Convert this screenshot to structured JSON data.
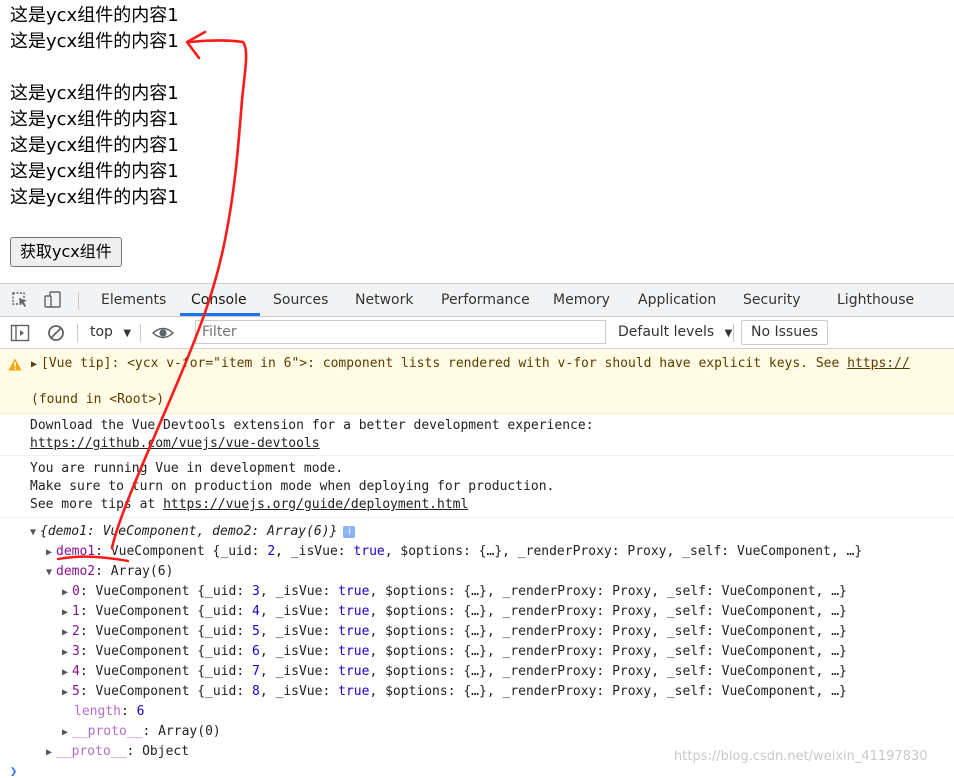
{
  "page": {
    "lines": [
      "这是ycx组件的内容1",
      "这是ycx组件的内容1",
      "这是ycx组件的内容1",
      "这是ycx组件的内容1",
      "这是ycx组件的内容1",
      "这是ycx组件的内容1",
      "这是ycx组件的内容1"
    ],
    "button_label": "获取ycx组件"
  },
  "devtools": {
    "tabs": [
      "Elements",
      "Console",
      "Sources",
      "Network",
      "Performance",
      "Memory",
      "Application",
      "Security",
      "Lighthouse"
    ],
    "active_tab": "Console",
    "accent_color": "#1a73e8"
  },
  "console_toolbar": {
    "context": "top",
    "filter_placeholder": "Filter",
    "levels": "Default levels",
    "issues": "No Issues"
  },
  "messages": {
    "warning": {
      "prefix": "[Vue tip]: ",
      "body": "<ycx v-for=\"item in 6\">: component lists rendered with v-for should have explicit keys. See ",
      "link": "https://",
      "found": "(found in <Root>)"
    },
    "devtools_tip": {
      "line1": "Download the Vue Devtools extension for a better development experience:",
      "link": "https://github.com/vuejs/vue-devtools"
    },
    "dev_mode": {
      "line1": "You are running Vue in development mode.",
      "line2": "Make sure to turn on production mode when deploying for production.",
      "line3_prefix": "See more tips at ",
      "link": "https://vuejs.org/guide/deployment.html"
    },
    "object": {
      "summary": "{demo1: VueComponent, demo2: Array(6)}",
      "demo1_key": "demo1",
      "demo1_value_prefix": ": VueComponent {_uid: ",
      "demo1_uid": "2",
      "demo1_isvue_label": ", _isVue: ",
      "demo1_isvue": "true",
      "demo1_rest": ", $options: {…}, _renderProxy: Proxy, _self: VueComponent, …}",
      "demo2_key": "demo2",
      "demo2_value": ": Array(6)",
      "items": [
        {
          "index": "0",
          "uid": "3"
        },
        {
          "index": "1",
          "uid": "4"
        },
        {
          "index": "2",
          "uid": "5"
        },
        {
          "index": "3",
          "uid": "6"
        },
        {
          "index": "4",
          "uid": "7"
        },
        {
          "index": "5",
          "uid": "8"
        }
      ],
      "item_prefix": ": VueComponent {_uid: ",
      "item_isvue_label": ", _isVue: ",
      "item_isvue": "true",
      "item_rest": ", $options: {…}, _renderProxy: Proxy, _self: VueComponent, …}",
      "length_key": "length",
      "length_value": "6",
      "proto_key": "__proto__",
      "array_proto_value": ": Array(0)",
      "object_proto_value": ": Object"
    }
  },
  "watermark": "https://blog.csdn.net/weixin_41197830",
  "annotation_color": "#ff0000"
}
